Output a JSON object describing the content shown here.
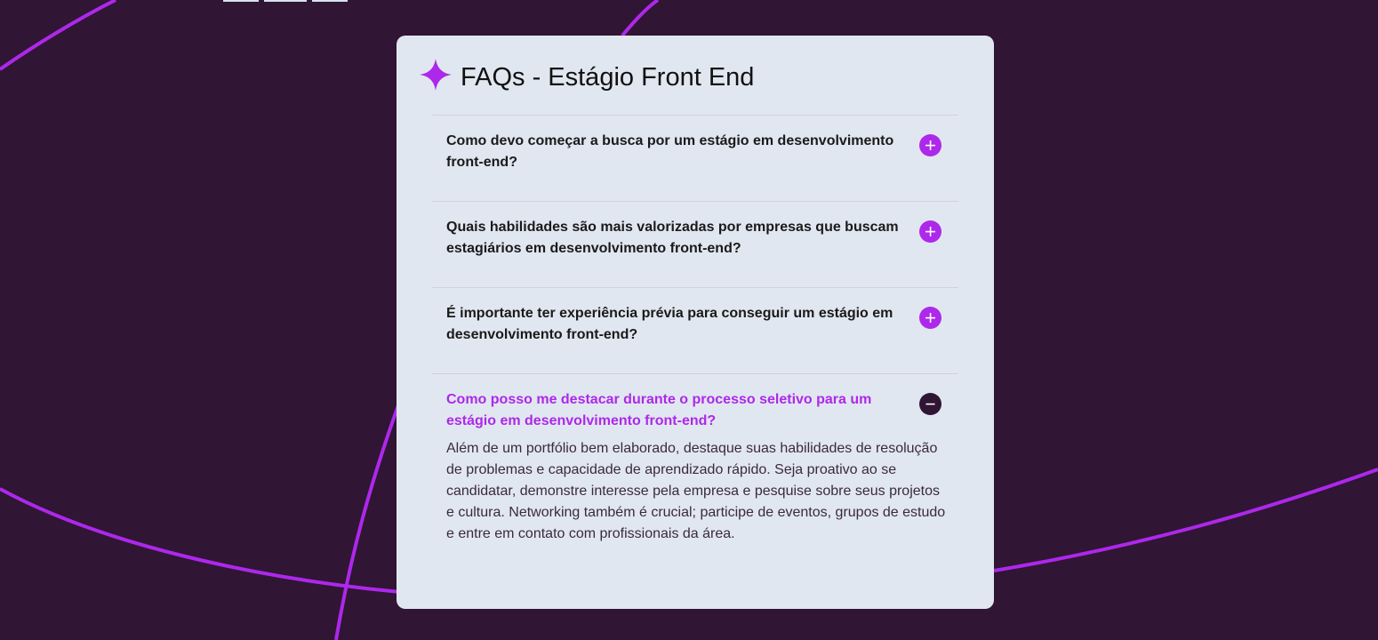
{
  "page": {
    "title": "FAQs - Estágio Front End",
    "accent_color": "#ad28eb",
    "background_color": "#301534",
    "card_color": "#e1e7f0"
  },
  "header": {
    "icon": "star-icon"
  },
  "faqs": [
    {
      "question": "Como devo começar a busca por um estágio em desenvolvimento front-end?",
      "expanded": false,
      "toggle_icon": "plus-icon"
    },
    {
      "question": "Quais habilidades são mais valorizadas por empresas que buscam estagiários em desenvolvimento front-end?",
      "expanded": false,
      "toggle_icon": "plus-icon"
    },
    {
      "question": "É importante ter experiência prévia para conseguir um estágio em desenvolvimento front-end?",
      "expanded": false,
      "toggle_icon": "plus-icon"
    },
    {
      "question": "Como posso me destacar durante o processo seletivo para um estágio em desenvolvimento front-end?",
      "answer": "Além de um portfólio bem elaborado, destaque suas habilidades de resolução de problemas e capacidade de aprendizado rápido. Seja proativo ao se candidatar, demonstre interesse pela empresa e pesquise sobre seus projetos e cultura. Networking também é crucial; participe de eventos, grupos de estudo e entre em contato com profissionais da área.",
      "expanded": true,
      "toggle_icon": "minus-icon"
    }
  ]
}
